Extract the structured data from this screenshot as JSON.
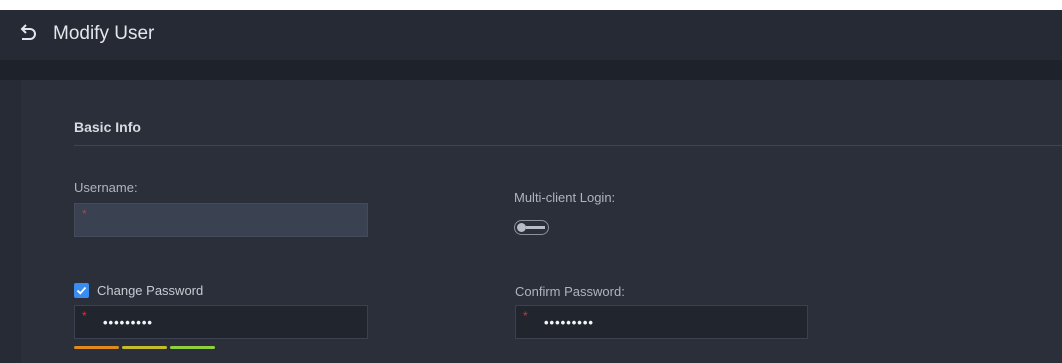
{
  "header": {
    "title": "Modify User",
    "back_icon": "back-arrow-icon"
  },
  "section": {
    "title": "Basic Info"
  },
  "fields": {
    "username": {
      "label": "Username:",
      "required_mark": "*",
      "value": ""
    },
    "multi_client_login": {
      "label": "Multi-client Login:",
      "enabled": false
    },
    "change_password": {
      "label": "Change Password",
      "checked": true
    },
    "password": {
      "required_mark": "*",
      "masked_value": "•••••••••"
    },
    "confirm_password": {
      "label": "Confirm Password:",
      "required_mark": "*",
      "masked_value": "•••••••••"
    }
  },
  "password_strength": {
    "level": 3,
    "max": 3,
    "colors": [
      "#e08a1e",
      "#c7bc2a",
      "#8fd13a"
    ]
  },
  "colors": {
    "accent": "#3b8cf0",
    "required": "#e0302d",
    "background": "#262b35",
    "panel": "#2a2f3a"
  }
}
